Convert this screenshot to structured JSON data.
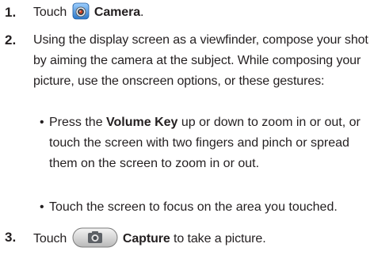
{
  "steps": [
    {
      "number": "1.",
      "before": "Touch",
      "icon": "camera-app-icon",
      "bold": "Camera",
      "after": "."
    },
    {
      "number": "2.",
      "text": "Using the display screen as a viewfinder, compose your shot by aiming the camera at the subject. While composing your picture, use the onscreen options, or these gestures:",
      "bullets": [
        {
          "before": "Press the",
          "bold": "Volume Key",
          "after": "up or down to zoom in or out, or touch the screen with two fingers and pinch or spread them on the screen to zoom in or out."
        },
        {
          "text": "Touch the screen to focus on the area you touched."
        }
      ]
    },
    {
      "number": "3.",
      "before": "Touch",
      "icon": "capture-button-icon",
      "bold": "Capture",
      "after": "to take a picture."
    }
  ],
  "bullet_glyph": "•"
}
